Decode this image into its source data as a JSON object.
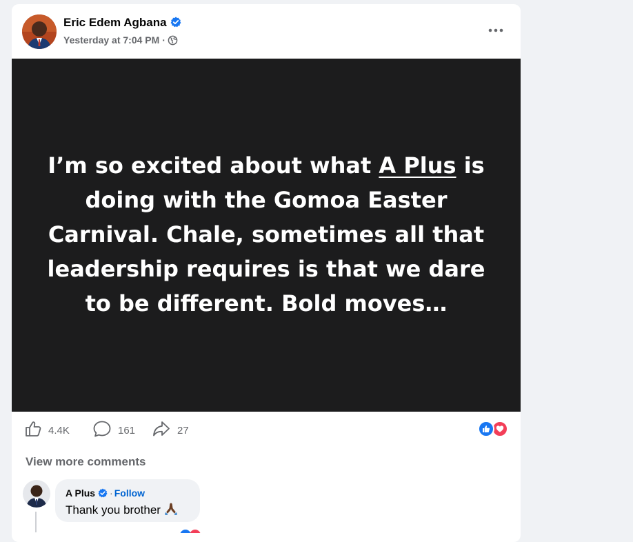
{
  "post": {
    "author": "Eric Edem Agbana",
    "timestamp": "Yesterday at 7:04 PM",
    "separator": "·",
    "audience_icon": "globe-icon",
    "more_icon": "more-horizontal-icon",
    "text_line1_before": "I’m so excited about what ",
    "mention": "A Plus",
    "text_line1_after": " is",
    "text_rest": "doing with the Gomoa Easter Carnival. Chale, sometimes all that leadership requires is that we dare to be different. Bold moves…",
    "background_color": "#1c1c1d"
  },
  "actions": {
    "likes": "4.4K",
    "comments": "161",
    "shares": "27"
  },
  "reactions": [
    "like",
    "love"
  ],
  "view_more_label": "View more comments",
  "comment": {
    "author": "A Plus",
    "separator": "·",
    "follow_label": "Follow",
    "text": "Thank you brother",
    "emoji": "🙏🏿"
  },
  "colors": {
    "accent": "#1877f2",
    "love": "#f33e58",
    "link": "#0064d1",
    "muted": "#65676b",
    "page_bg": "#f0f2f5"
  }
}
